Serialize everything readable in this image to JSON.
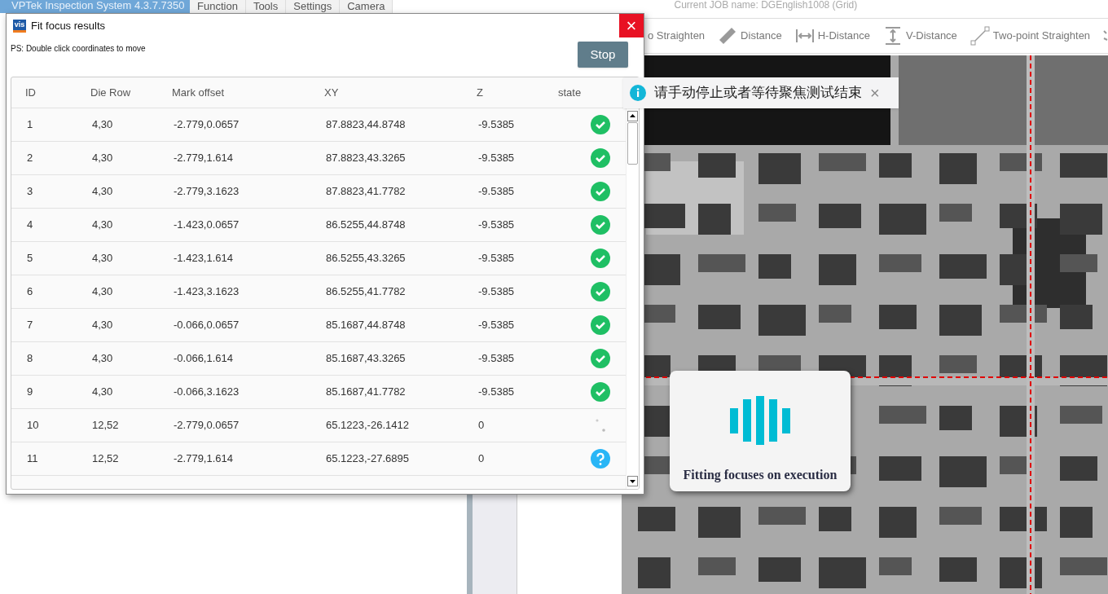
{
  "app": {
    "title": "VPTek Inspection System 4.3.7.7350",
    "menu": [
      {
        "label": "Function"
      },
      {
        "label": "Tools"
      },
      {
        "label": "Settings"
      },
      {
        "label": "Camera"
      }
    ],
    "job": "Current JOB name: DGEnglish1008 (Grid)"
  },
  "toolbar": [
    {
      "kind": "straighten",
      "label": "o Straighten"
    },
    {
      "kind": "ruler",
      "label": "Distance"
    },
    {
      "kind": "hdist",
      "label": "H-Distance"
    },
    {
      "kind": "vdist",
      "label": "V-Distance"
    },
    {
      "kind": "twopoint",
      "label": "Two-point Straighten"
    },
    {
      "kind": "points"
    }
  ],
  "dialog": {
    "logo": "vis",
    "title": "Fit focus results",
    "close": "×",
    "hint": "PS: Double click coordinates to move",
    "stop": "Stop",
    "columns": [
      "ID",
      "Die Row",
      "Mark offset",
      "XY",
      "Z",
      "state"
    ],
    "rows": [
      {
        "cells": [
          "1",
          "4,30",
          "-2.779,0.0657",
          "87.8823,44.8748",
          "-9.5385"
        ],
        "kind": "ok"
      },
      {
        "cells": [
          "2",
          "4,30",
          "-2.779,1.614",
          "87.8823,43.3265",
          "-9.5385"
        ],
        "kind": "ok"
      },
      {
        "cells": [
          "3",
          "4,30",
          "-2.779,3.1623",
          "87.8823,41.7782",
          "-9.5385"
        ],
        "kind": "ok"
      },
      {
        "cells": [
          "4",
          "4,30",
          "-1.423,0.0657",
          "86.5255,44.8748",
          "-9.5385"
        ],
        "kind": "ok"
      },
      {
        "cells": [
          "5",
          "4,30",
          "-1.423,1.614",
          "86.5255,43.3265",
          "-9.5385"
        ],
        "kind": "ok"
      },
      {
        "cells": [
          "6",
          "4,30",
          "-1.423,3.1623",
          "86.5255,41.7782",
          "-9.5385"
        ],
        "kind": "ok"
      },
      {
        "cells": [
          "7",
          "4,30",
          "-0.066,0.0657",
          "85.1687,44.8748",
          "-9.5385"
        ],
        "kind": "ok"
      },
      {
        "cells": [
          "8",
          "4,30",
          "-0.066,1.614",
          "85.1687,43.3265",
          "-9.5385"
        ],
        "kind": "ok"
      },
      {
        "cells": [
          "9",
          "4,30",
          "-0.066,3.1623",
          "85.1687,41.7782",
          "-9.5385"
        ],
        "kind": "ok"
      },
      {
        "cells": [
          "10",
          "12,52",
          "-2.779,0.0657",
          "65.1223,-26.1412",
          "0"
        ],
        "kind": "loading"
      },
      {
        "cells": [
          "11",
          "12,52",
          "-2.779,1.614",
          "65.1223,-27.6895",
          "0"
        ],
        "kind": "pending"
      }
    ]
  },
  "toast": {
    "text": "请手动停止或者等待聚焦测试结束",
    "close": "×"
  },
  "loader": {
    "text": "Fitting focuses on execution"
  }
}
